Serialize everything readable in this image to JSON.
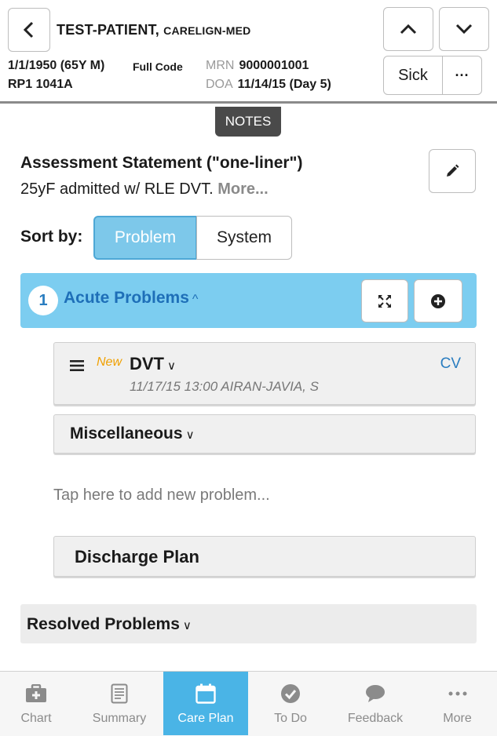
{
  "header": {
    "patient_name": "TEST-PATIENT,",
    "org": "CARELIGN-MED",
    "dob": "1/1/1950 (65Y M)",
    "code_status": "Full Code",
    "room": "RP1 1041A",
    "mrn_label": "MRN",
    "mrn": "9000001001",
    "doa_label": "DOA",
    "doa": "11/14/15 (Day 5)",
    "sick_label": "Sick",
    "more_label": "···"
  },
  "notes_tab": "NOTES",
  "assessment": {
    "title": "Assessment Statement (\"one-liner\")",
    "text": "25yF admitted w/ RLE DVT.",
    "more_link": "More..."
  },
  "sort": {
    "label": "Sort by:",
    "options": [
      "Problem",
      "System"
    ],
    "selected": "Problem"
  },
  "acute": {
    "count": "1",
    "title": "Acute Problems"
  },
  "problems": [
    {
      "tag": "New",
      "name": "DVT",
      "meta": "11/17/15 13:00 AIRAN-JAVIA, S",
      "system": "CV"
    }
  ],
  "misc_label": "Miscellaneous",
  "add_problem_placeholder": "Tap here to add new problem...",
  "discharge_label": "Discharge Plan",
  "resolved_label": "Resolved Problems",
  "nav": [
    {
      "label": "Chart",
      "icon": "briefcase-icon"
    },
    {
      "label": "Summary",
      "icon": "document-icon"
    },
    {
      "label": "Care Plan",
      "icon": "calendar-icon",
      "active": true
    },
    {
      "label": "To Do",
      "icon": "checkmark-circle-icon"
    },
    {
      "label": "Feedback",
      "icon": "speech-bubble-icon"
    },
    {
      "label": "More",
      "icon": "ellipsis-icon"
    }
  ],
  "colors": {
    "accent": "#7ccdf0",
    "accent_dark": "#1e6fb8",
    "nav_active": "#4ab4e6",
    "new_tag": "#f0a000"
  }
}
